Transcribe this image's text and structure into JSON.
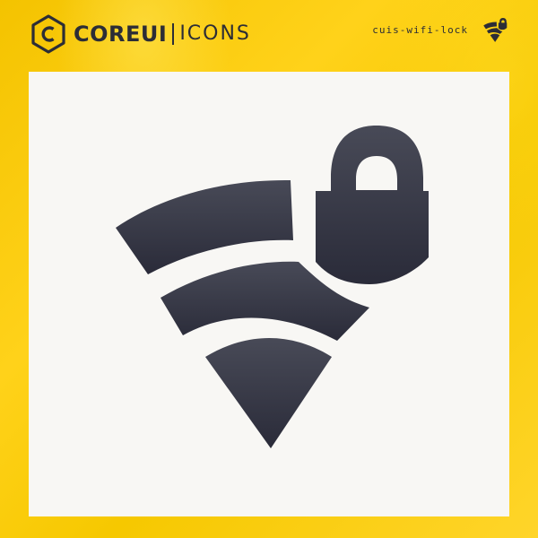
{
  "brand": {
    "name_bold": "COREUI",
    "name_light": "ICONS"
  },
  "icon": {
    "name": "cuis-wifi-lock",
    "semantic": "wifi-lock-icon"
  },
  "colors": {
    "background": "#f7c600",
    "card": "#f8f7f4",
    "icon": "#3b3c49",
    "text": "#2c2d36"
  }
}
